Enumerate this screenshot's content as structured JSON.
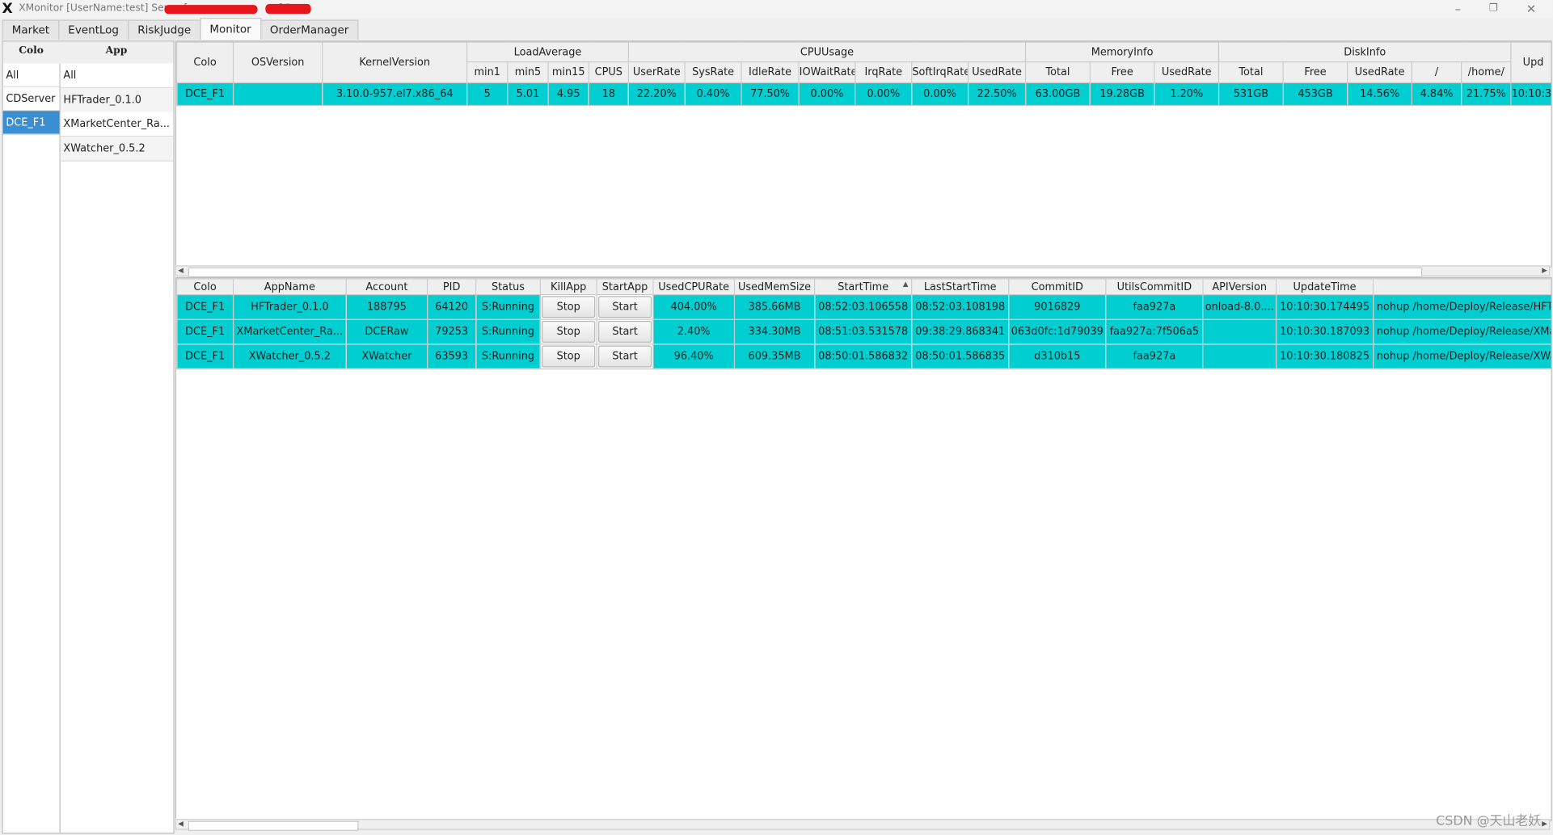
{
  "window": {
    "title": "XMonitor [UserName:test] Server[",
    "title_at": "]@",
    "min_icon": "minimize-icon",
    "restore_icon": "restore-icon",
    "close_icon": "close-icon",
    "logo": "X"
  },
  "tabs": [
    {
      "label": "Market"
    },
    {
      "label": "EventLog"
    },
    {
      "label": "RiskJudge"
    },
    {
      "label": "Monitor",
      "active": true
    },
    {
      "label": "OrderManager"
    }
  ],
  "filter": {
    "colo_header": "Colo",
    "app_header": "App",
    "colos": [
      "All",
      "CDServer",
      "DCE_F1"
    ],
    "selected_colo": "DCE_F1",
    "apps": [
      "All",
      "HFTrader_0.1.0",
      "XMarketCenter_Ra...",
      "XWatcher_0.5.2"
    ]
  },
  "host_table": {
    "groups": [
      {
        "label": "Colo",
        "span": 1,
        "rows": 2
      },
      {
        "label": "OSVersion",
        "span": 1,
        "rows": 2
      },
      {
        "label": "KernelVersion",
        "span": 1,
        "rows": 2
      },
      {
        "label": "LoadAverage",
        "span": 4
      },
      {
        "label": "CPUUsage",
        "span": 7
      },
      {
        "label": "MemoryInfo",
        "span": 3
      },
      {
        "label": "DiskInfo",
        "span": 5
      },
      {
        "label": "Upd",
        "span": 1,
        "rows": 2
      }
    ],
    "subheaders": [
      "min1",
      "min5",
      "min15",
      "CPUS",
      "UserRate",
      "SysRate",
      "IdleRate",
      "IOWaitRate",
      "IrqRate",
      "SoftIrqRate",
      "UsedRate",
      "Total",
      "Free",
      "UsedRate",
      "Total",
      "Free",
      "UsedRate",
      "/",
      "/home/"
    ],
    "rows": [
      [
        "DCE_F1",
        "",
        "3.10.0-957.el7.x86_64",
        "5",
        "5.01",
        "4.95",
        "18",
        "22.20%",
        "0.40%",
        "77.50%",
        "0.00%",
        "0.00%",
        "0.00%",
        "22.50%",
        "63.00GB",
        "19.28GB",
        "1.20%",
        "531GB",
        "453GB",
        "14.56%",
        "4.84%",
        "21.75%",
        "10:10:3"
      ]
    ]
  },
  "app_table": {
    "headers": [
      "Colo",
      "AppName",
      "Account",
      "PID",
      "Status",
      "KillApp",
      "StartApp",
      "UsedCPURate",
      "UsedMemSize",
      "StartTime",
      "LastStartTime",
      "CommitID",
      "UtilsCommitID",
      "APIVersion",
      "UpdateTime",
      ""
    ],
    "sorted_column": "StartTime",
    "sort_icon": "sort-ascending-icon",
    "rows": [
      [
        "DCE_F1",
        "HFTrader_0.1.0",
        "188795",
        "64120",
        "S:Running",
        "Stop",
        "Start",
        "404.00%",
        "385.66MB",
        "08:52:03.106558",
        "08:52:03.108198",
        "9016829",
        "faa927a",
        "onload-8.0....",
        "10:10:30.174495",
        "nohup /home/Deploy/Release/HFTra"
      ],
      [
        "DCE_F1",
        "XMarketCenter_Ra...",
        "DCERaw",
        "79253",
        "S:Running",
        "Stop",
        "Start",
        "2.40%",
        "334.30MB",
        "08:51:03.531578",
        "09:38:29.868341",
        "063d0fc:1d79039",
        "faa927a:7f506a5",
        "",
        "10:10:30.187093",
        "nohup /home/Deploy/Release/XMark"
      ],
      [
        "DCE_F1",
        "XWatcher_0.5.2",
        "XWatcher",
        "63593",
        "S:Running",
        "Stop",
        "Start",
        "96.40%",
        "609.35MB",
        "08:50:01.586832",
        "08:50:01.586835",
        "d310b15",
        "faa927a",
        "",
        "10:10:30.180825",
        "nohup /home/Deploy/Release/XWatc"
      ]
    ]
  },
  "colors": {
    "row_bg": "#00ced1",
    "selected": "#3b8ed0",
    "redaction": "#e8141e"
  },
  "watermark": "CSDN @天山老妖"
}
